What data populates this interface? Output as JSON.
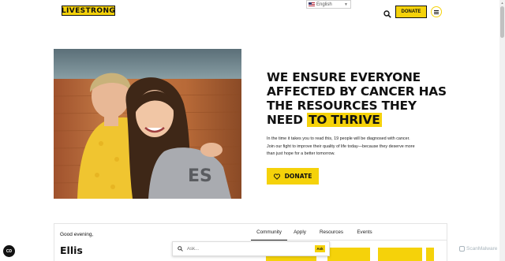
{
  "header": {
    "logo_text": "LIVESTRONG",
    "language": {
      "selected": "English",
      "flag": "us-flag-icon"
    },
    "search_icon": "search-icon",
    "donate_label": "DONATE",
    "menu_icon": "hamburger-menu-icon"
  },
  "hero": {
    "headline_part1": "WE ENSURE EVERYONE AFFECTED BY CANCER HAS THE RESOURCES THEY NEED",
    "headline_highlight": "TO THRIVE",
    "body": "In the time it takes you to read this, 19 people will be diagnosed with cancer. Join our fight to improve their quality of life today—because they deserve more than just hope for a better tomorrow.",
    "donate_label": "DONATE",
    "donate_icon": "heart-icon"
  },
  "panel": {
    "greeting": "Good evening,",
    "username": "Ellis",
    "tabs": [
      {
        "label": "Community",
        "active": true
      },
      {
        "label": "Apply",
        "active": false
      },
      {
        "label": "Resources",
        "active": false
      },
      {
        "label": "Events",
        "active": false
      }
    ],
    "ask": {
      "placeholder": "Ask...",
      "button_label": "Ask"
    }
  },
  "floating": {
    "badge_text": "CD",
    "watermark": "ScanMalware"
  },
  "colors": {
    "brand_yellow": "#f5d20a",
    "text": "#111111",
    "border": "#e4e4e4"
  }
}
